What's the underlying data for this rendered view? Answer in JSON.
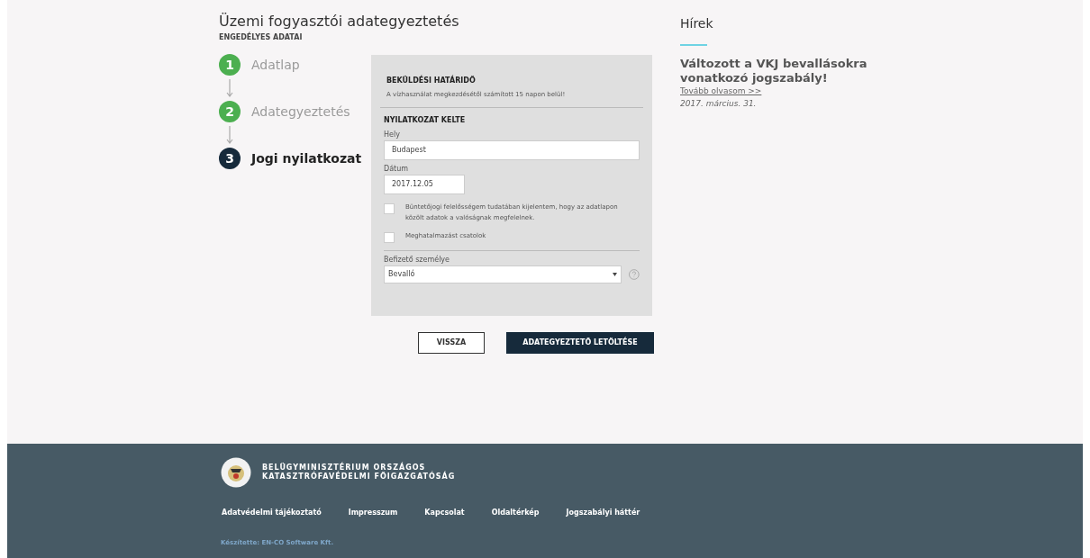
{
  "page": {
    "title": "Üzemi fogyasztói adategyeztetés",
    "subtitle": "ENGEDÉLYES ADATAI"
  },
  "steps": [
    {
      "number": "1",
      "label": "Adatlap",
      "selected": false
    },
    {
      "number": "2",
      "label": "Adategyeztetés",
      "selected": false
    },
    {
      "number": "3",
      "label": "Jogi nyilatkozat",
      "selected": true
    }
  ],
  "form": {
    "deadline_heading": "BEKÜLDÉSI HATÁRIDŐ",
    "deadline_text": "A vízhasználat megkezdésétől számított 15 napon belül!",
    "declaration_heading": "NYILATKOZAT KELTE",
    "place": {
      "label": "Hely",
      "value": "Budapest"
    },
    "date": {
      "label": "Dátum",
      "value": "2017.12.05"
    },
    "checkboxes": [
      {
        "label": "Büntetőjogi felelősségem tudatában kijelentem, hogy az adatlapon közölt adatok a valóságnak megfelelnek.",
        "checked": false
      },
      {
        "label": "Meghatalmazást csatolok",
        "checked": false
      }
    ],
    "payer": {
      "label": "Befizető személye",
      "value": "Bevalló"
    }
  },
  "buttons": [
    {
      "label": "VISSZA",
      "kind": "secondary"
    },
    {
      "label": "ADATEGYEZTETŐ LETÖLTÉSE",
      "kind": "primary"
    }
  ],
  "news": {
    "heading": "Hírek",
    "items": [
      {
        "title": "Változott a VKJ bevallásokra vonatkozó jogszabály!",
        "link": "Tovább olvasom >>",
        "date": "2017. március. 31."
      }
    ]
  },
  "footer": {
    "org_line_1": "BELÜGYMINISZTÉRIUM ORSZÁGOS",
    "org_line_2": "KATASZTRÓFAVÉDELMI FŐIGAZGATÓSÁG",
    "links": [
      "Adatvédelmi tájékoztató",
      "Impresszum",
      "Kapcsolat",
      "Oldaltérkép",
      "Jogszabályi háttér"
    ],
    "credit": "Készítette: EN-CO Software Kft."
  }
}
